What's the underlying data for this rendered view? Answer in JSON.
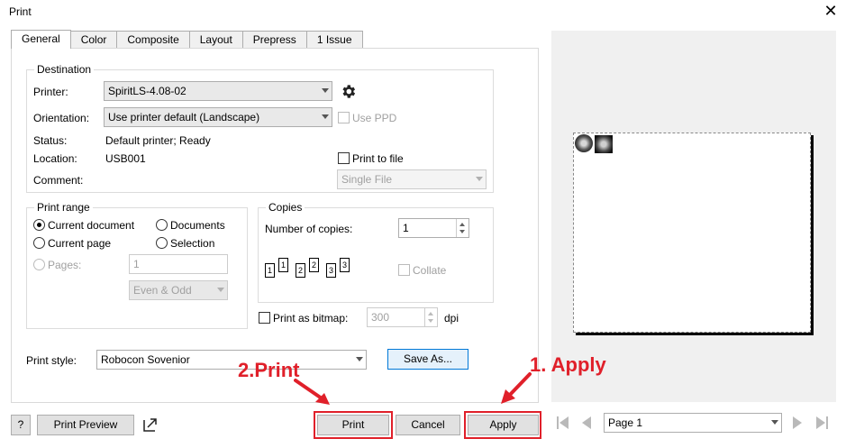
{
  "window": {
    "title": "Print",
    "close_glyph": "✕"
  },
  "tabs": [
    {
      "label": "General",
      "active": true
    },
    {
      "label": "Color",
      "active": false
    },
    {
      "label": "Composite",
      "active": false
    },
    {
      "label": "Layout",
      "active": false
    },
    {
      "label": "Prepress",
      "active": false
    },
    {
      "label": "1 Issue",
      "active": false
    }
  ],
  "destination": {
    "title": "Destination",
    "printer_label": "Printer:",
    "printer_value": "SpiritLS-4.08-02",
    "orientation_label": "Orientation:",
    "orientation_value": "Use printer default (Landscape)",
    "use_ppd_label": "Use PPD",
    "status_label": "Status:",
    "status_value": "Default printer; Ready",
    "location_label": "Location:",
    "location_value": "USB001",
    "comment_label": "Comment:",
    "print_to_file_label": "Print to file",
    "single_file_value": "Single File"
  },
  "print_range": {
    "title": "Print range",
    "current_document": "Current document",
    "documents": "Documents",
    "current_page": "Current page",
    "selection": "Selection",
    "pages_label": "Pages:",
    "pages_value": "1",
    "even_odd_value": "Even & Odd"
  },
  "copies": {
    "title": "Copies",
    "number_label": "Number of copies:",
    "number_value": "1",
    "collate_label": "Collate",
    "page_icon_labels": [
      "1",
      "1",
      "2",
      "2",
      "3",
      "3"
    ]
  },
  "bitmap": {
    "label": "Print as bitmap:",
    "value": "300",
    "unit": "dpi"
  },
  "print_style": {
    "label": "Print style:",
    "value": "Robocon Sovenior",
    "save_as_label": "Save As..."
  },
  "footer": {
    "help_label": "?",
    "print_preview_label": "Print Preview",
    "print_label": "Print",
    "cancel_label": "Cancel",
    "apply_label": "Apply"
  },
  "preview": {
    "page_value": "Page 1"
  },
  "annotations": {
    "step1": "1. Apply",
    "step2": "2.Print",
    "color": "#e0202a"
  }
}
